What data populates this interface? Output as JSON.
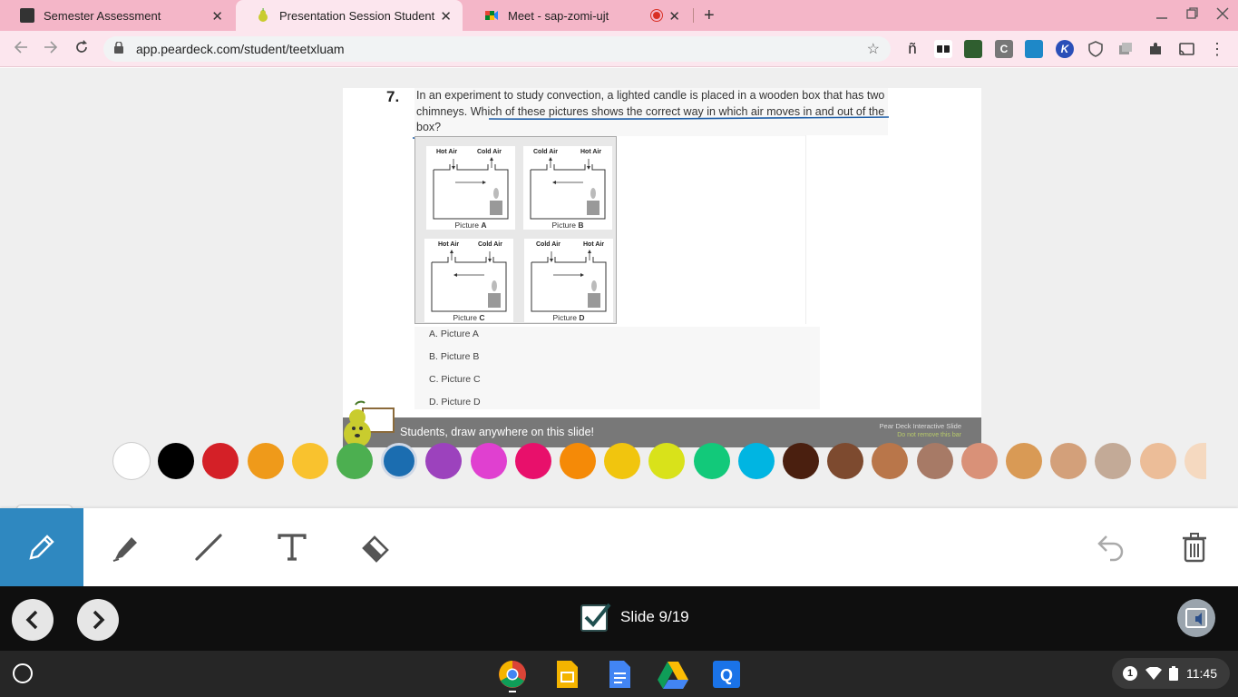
{
  "browser": {
    "tabs": [
      {
        "title": "Semester Assessment",
        "active": false
      },
      {
        "title": "Presentation Session Student",
        "active": true
      },
      {
        "title": "Meet - sap-zomi-ujt",
        "active": false
      }
    ],
    "new_tab_symbol": "+",
    "close_symbol": "✕",
    "url": "app.peardeck.com/student/teetxluam",
    "extensions": [
      "ñ",
      "C",
      "K"
    ]
  },
  "slide": {
    "question_number": "7.",
    "question_text": "In an experiment to study convection, a lighted candle is placed in a wooden box that has two chimneys. Which of these pictures shows the correct way in which air moves in and out of the box?",
    "pictures": [
      {
        "left_label": "Hot Air",
        "right_label": "Cold Air",
        "caption_prefix": "Picture ",
        "caption_letter": "A"
      },
      {
        "left_label": "Cold Air",
        "right_label": "Hot Air",
        "caption_prefix": "Picture ",
        "caption_letter": "B"
      },
      {
        "left_label": "Hot Air",
        "right_label": "Cold Air",
        "caption_prefix": "Picture ",
        "caption_letter": "C"
      },
      {
        "left_label": "Cold Air",
        "right_label": "Hot Air",
        "caption_prefix": "Picture ",
        "caption_letter": "D"
      }
    ],
    "choices": [
      "A. Picture A",
      "B. Picture B",
      "C. Picture C",
      "D. Picture D"
    ],
    "bar_message": "Students, draw anywhere on this slide!",
    "bar_brand": "Pear Deck Interactive Slide",
    "bar_note": "Do not remove this bar"
  },
  "palette": {
    "colors": [
      "#ffffff",
      "#000000",
      "#d42027",
      "#ef9a1a",
      "#f9c22e",
      "#4caf50",
      "#1b6db0",
      "#9c42bd",
      "#e040d0",
      "#e8106b",
      "#f58a07",
      "#f1c50e",
      "#d9e21a",
      "#12c97a",
      "#00b5e2",
      "#4a1f0f",
      "#7d4a2f",
      "#b9764a",
      "#a77a66",
      "#d99178",
      "#d99a55",
      "#d3a07a",
      "#c3aa97",
      "#ecbd98",
      "#f5d9c0"
    ],
    "selected_index": 6
  },
  "tools": [
    "pen-tool",
    "highlighter-tool",
    "line-tool",
    "text-tool",
    "eraser-tool"
  ],
  "nav": {
    "slide_label": "Slide 9/19"
  },
  "shelf": {
    "time": "11:45",
    "notification_count": "1"
  }
}
